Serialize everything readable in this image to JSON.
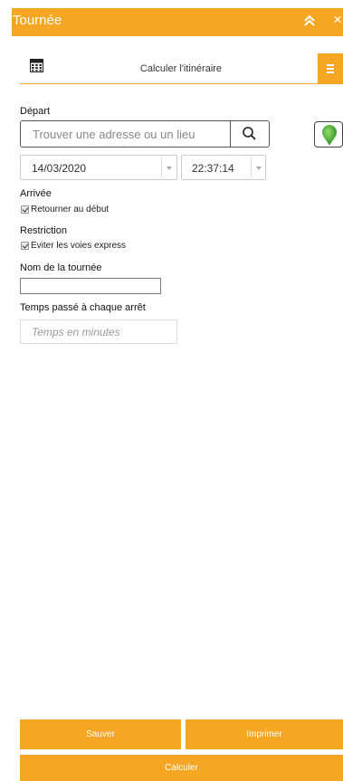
{
  "header": {
    "title": "Tournée",
    "collapse_icon": "double-chevron-up-icon",
    "close_icon": "close-icon",
    "close_glyph": "×"
  },
  "toolbar": {
    "icon": "calculator-icon",
    "title": "Calculer l'itinéraire",
    "menu_icon": "hamburger-menu-icon"
  },
  "departure": {
    "label": "Départ",
    "search_placeholder": "Trouver une adresse ou un lieu",
    "search_icon": "search-icon",
    "pin_icon": "map-pin-icon",
    "date": "14/03/2020",
    "time": "22:37:14"
  },
  "arrival": {
    "label": "Arrivée",
    "return_to_start": {
      "label": "Retourner au début",
      "checked": true
    }
  },
  "restriction": {
    "label": "Restriction",
    "avoid_highways": {
      "label": "Eviter les voies express",
      "checked": true
    }
  },
  "tour_name": {
    "label": "Nom de la tournée",
    "value": ""
  },
  "stop_time": {
    "label": "Temps passé à chaque arrêt",
    "placeholder": "Temps en minutes"
  },
  "actions": {
    "save": "Sauver",
    "print": "Imprimer",
    "calculate": "Calculer"
  },
  "colors": {
    "accent": "#f5a623",
    "pin_green": "#3aa12f"
  }
}
